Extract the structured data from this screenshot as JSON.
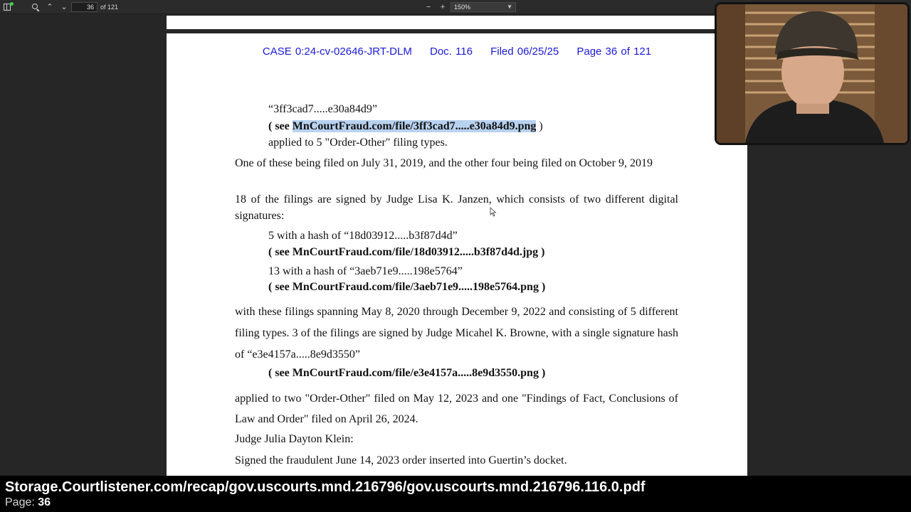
{
  "toolbar": {
    "page_number": "36",
    "page_of": "of 121",
    "zoom": "150%",
    "icons": [
      "sidebar-icon",
      "search-icon",
      "chevron-up-icon",
      "chevron-down-icon",
      "zoom-out-icon",
      "zoom-in-icon",
      "chevron-down-icon"
    ]
  },
  "document": {
    "header": {
      "case": "CASE 0:24-cv-02646-JRT-DLM",
      "doc": "Doc. 116",
      "filed": "Filed 06/25/25",
      "page": "Page 36 of 121"
    },
    "hash1": "“3ff3cad7.....e30a84d9”",
    "link1_prefix": "( see ",
    "link1_url": "MnCourtFraud.com/file/3ff3cad7.....e30a84d9.png",
    "link1_suffix": " )",
    "applied1": "applied to 5 \"Order-Other\" filing types.",
    "para1": "One of these being filed on July 31, 2019, and the other four being filed on October 9, 2019",
    "para2": "18 of the filings are signed by Judge Lisa K. Janzen, which consists of two different digital signatures:",
    "hash2": "5 with a hash of “18d03912.....b3f87d4d”",
    "link2": "( see MnCourtFraud.com/file/18d03912.....b3f87d4d.jpg )",
    "hash3": "13 with a hash of “3aeb71e9.....198e5764”",
    "link3": "( see MnCourtFraud.com/file/3aeb71e9.....198e5764.png )",
    "para3": "with these filings spanning May 8, 2020 through December 9, 2022 and consisting of 5 different filing types. 3 of the filings are signed by Judge Micahel K. Browne, with a single signature hash of “e3e4157a.....8e9d3550”",
    "link4": "( see MnCourtFraud.com/file/e3e4157a.....8e9d3550.png )",
    "para4": "applied to two \"Order-Other\" filed on May 12, 2023 and one \"Findings of Fact, Conclusions of Law and Order\" filed on April 26, 2024.",
    "judge_heading": "Judge Julia Dayton Klein:",
    "para5": "Signed the fraudulent June 14, 2023 order inserted into Guertin’s docket."
  },
  "caption": {
    "url": "Storage.Courtlistener.com/recap/gov.uscourts.mnd.216796/gov.uscourts.mnd.216796.116.0.pdf",
    "page_label": "Page:",
    "page_value": "36"
  },
  "colors": {
    "header_blue": "#1a1ad6",
    "highlight": "#b8d2f0",
    "toolbar_bg": "#2b2b2b",
    "viewer_bg": "#262626"
  }
}
